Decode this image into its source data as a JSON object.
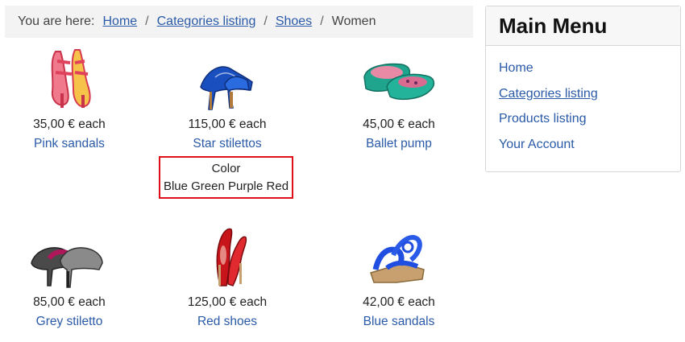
{
  "breadcrumb": {
    "lead": "You are here:",
    "items": [
      "Home",
      "Categories listing",
      "Shoes"
    ],
    "current": "Women",
    "separator": "/"
  },
  "products": [
    {
      "price": "35,00 € each",
      "name": "Pink sandals",
      "color": "#e8506a"
    },
    {
      "price": "115,00 € each",
      "name": "Star stilettos",
      "color": "#1a4fbf"
    },
    {
      "price": "45,00 € each",
      "name": "Ballet pump",
      "color": "#1fa58e"
    },
    {
      "price": "85,00 € each",
      "name": "Grey stiletto",
      "color": "#6e6e6e"
    },
    {
      "price": "125,00 € each",
      "name": "Red shoes",
      "color": "#c8151b"
    },
    {
      "price": "42,00 € each",
      "name": "Blue sandals",
      "color": "#1f4ee0"
    }
  ],
  "attributes": {
    "label": "Color",
    "values": "Blue Green Purple Red"
  },
  "menu": {
    "title": "Main Menu",
    "items": [
      "Home",
      "Categories listing",
      "Products listing",
      "Your Account"
    ]
  },
  "colors": {
    "link": "#2a5aa8",
    "highlight_border": "#e0101a"
  }
}
